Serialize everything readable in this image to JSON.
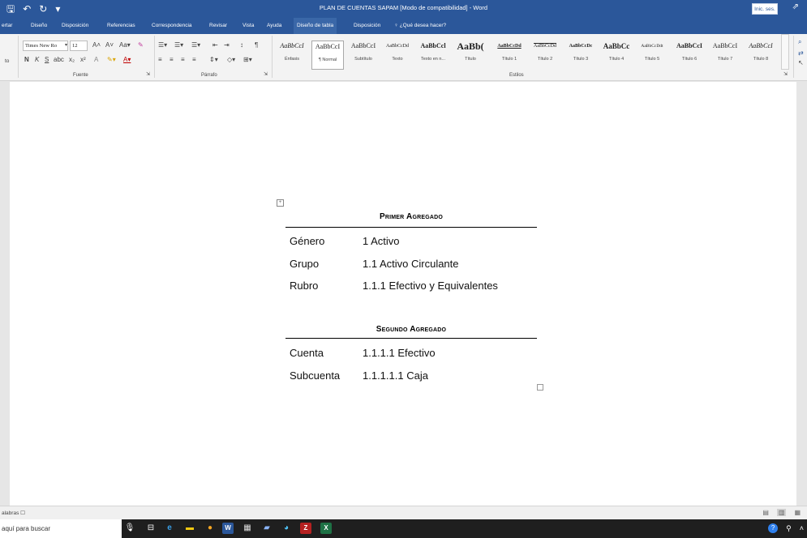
{
  "window": {
    "title": "PLAN DE CUENTAS SAPAM [Modo de compatibilidad] - Word",
    "signin_label": "Inic. ses."
  },
  "tabs": [
    {
      "label": "ertar"
    },
    {
      "label": "Diseño"
    },
    {
      "label": "Disposición"
    },
    {
      "label": "Referencias"
    },
    {
      "label": "Correspondencia"
    },
    {
      "label": "Revisar"
    },
    {
      "label": "Vista"
    },
    {
      "label": "Ayuda"
    },
    {
      "label": "Diseño de tabla"
    },
    {
      "label": "Disposición"
    }
  ],
  "tell_me": "¿Qué desea hacer?",
  "ribbon": {
    "font_name": "Times New Ro",
    "font_size": "12",
    "groups": {
      "fuente": "Fuente",
      "parrafo": "Párrafo",
      "estilos": "Estilos"
    },
    "left_cut_label": "to",
    "styles": [
      {
        "sample": "AaBbCcI",
        "name": "Énfasis"
      },
      {
        "sample": "AaBbCcI",
        "name": "¶ Normal"
      },
      {
        "sample": "AaBbCcI",
        "name": "Subtítulo"
      },
      {
        "sample": "AaBbCcDd",
        "name": "Texto"
      },
      {
        "sample": "AaBbCcl",
        "name": "Texto en n..."
      },
      {
        "sample": "AaBb(",
        "name": "Título"
      },
      {
        "sample": "AaBbCcDd",
        "name": "Título 1"
      },
      {
        "sample": "AaBbCcDd",
        "name": "Título 2"
      },
      {
        "sample": "AaBbCcDc",
        "name": "Título 3"
      },
      {
        "sample": "AaBbCc",
        "name": "Título 4"
      },
      {
        "sample": "AaBbCcDdt",
        "name": "Título 5"
      },
      {
        "sample": "AaBbCcI",
        "name": "Título 6"
      },
      {
        "sample": "AaBbCcI",
        "name": "Título 7"
      },
      {
        "sample": "AaBbCcI",
        "name": "Título 8"
      }
    ]
  },
  "document": {
    "section1": {
      "title": "Primer Agregado",
      "rows": [
        {
          "label": "Género",
          "value": "1 Activo"
        },
        {
          "label": "Grupo",
          "value": "1.1 Activo Circulante"
        },
        {
          "label": "Rubro",
          "value": "1.1.1 Efectivo y Equivalentes"
        }
      ]
    },
    "section2": {
      "title": "Segundo Agregado",
      "rows": [
        {
          "label": "Cuenta",
          "value": "1.1.1.1 Efectivo"
        },
        {
          "label": "Subcuenta",
          "value": "1.1.1.1.1 Caja"
        }
      ]
    }
  },
  "status": {
    "words": "alabras"
  },
  "taskbar": {
    "search_placeholder": "aquí para buscar"
  },
  "colors": {
    "word_blue": "#2b579a",
    "taskbar": "#1f1f1f"
  }
}
